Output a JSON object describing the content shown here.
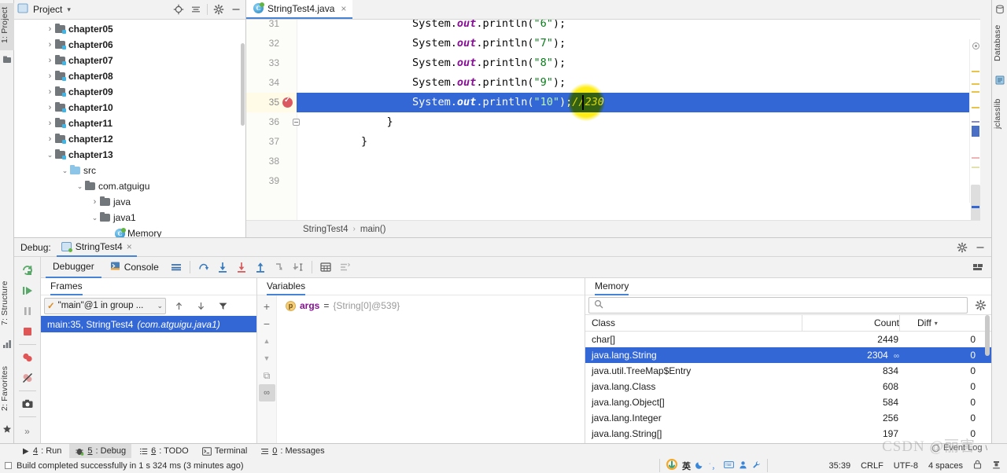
{
  "leftbar": {
    "top_items": [
      {
        "label": "1: Project",
        "selected": true
      }
    ],
    "bottom_items": [
      {
        "label": "7: Structure"
      },
      {
        "label": "2: Favorites"
      }
    ]
  },
  "project_panel": {
    "title": "Project",
    "dropdown_caret": "▾",
    "icons": [
      {
        "name": "locate-icon",
        "glyph": "⊕"
      },
      {
        "name": "collapse-all-icon",
        "glyph": "≑"
      },
      {
        "name": "settings-gear-icon",
        "glyph": "✿"
      },
      {
        "name": "hide-panel-icon",
        "glyph": "—"
      }
    ],
    "tree": [
      {
        "label": "chapter05",
        "indent": 1,
        "arrow": "›",
        "icon": "folder-module",
        "bold": true
      },
      {
        "label": "chapter06",
        "indent": 1,
        "arrow": "›",
        "icon": "folder-module",
        "bold": true
      },
      {
        "label": "chapter07",
        "indent": 1,
        "arrow": "›",
        "icon": "folder-module",
        "bold": true
      },
      {
        "label": "chapter08",
        "indent": 1,
        "arrow": "›",
        "icon": "folder-module",
        "bold": true
      },
      {
        "label": "chapter09",
        "indent": 1,
        "arrow": "›",
        "icon": "folder-module",
        "bold": true
      },
      {
        "label": "chapter10",
        "indent": 1,
        "arrow": "›",
        "icon": "folder-module",
        "bold": true
      },
      {
        "label": "chapter11",
        "indent": 1,
        "arrow": "›",
        "icon": "folder-module",
        "bold": true
      },
      {
        "label": "chapter12",
        "indent": 1,
        "arrow": "›",
        "icon": "folder-module",
        "bold": true
      },
      {
        "label": "chapter13",
        "indent": 1,
        "arrow": "⌄",
        "icon": "folder-module",
        "bold": true
      },
      {
        "label": "src",
        "indent": 2,
        "arrow": "⌄",
        "icon": "folder-src",
        "bold": false
      },
      {
        "label": "com.atguigu",
        "indent": 3,
        "arrow": "⌄",
        "icon": "folder-pkg",
        "bold": false
      },
      {
        "label": "java",
        "indent": 4,
        "arrow": "›",
        "icon": "folder-pkg",
        "bold": false
      },
      {
        "label": "java1",
        "indent": 4,
        "arrow": "⌄",
        "icon": "folder-pkg",
        "bold": false
      },
      {
        "label": "Memory",
        "indent": 5,
        "arrow": "",
        "icon": "java-class",
        "bold": false
      }
    ]
  },
  "editor": {
    "tab": {
      "label": "StringTest4.java",
      "close": "×",
      "icon": "java-class-icon"
    },
    "lines": [
      {
        "num": "31",
        "clipped": true,
        "segments": [
          {
            "t": "        System.",
            "c": "plain"
          },
          {
            "t": "out",
            "c": "field"
          },
          {
            "t": ".println(",
            "c": "plain"
          },
          {
            "t": "\"6\"",
            "c": "string"
          },
          {
            "t": ");",
            "c": "plain"
          }
        ]
      },
      {
        "num": "32",
        "segments": [
          {
            "t": "        System.",
            "c": "plain"
          },
          {
            "t": "out",
            "c": "field"
          },
          {
            "t": ".println(",
            "c": "plain"
          },
          {
            "t": "\"7\"",
            "c": "string"
          },
          {
            "t": ");",
            "c": "plain"
          }
        ]
      },
      {
        "num": "33",
        "segments": [
          {
            "t": "        System.",
            "c": "plain"
          },
          {
            "t": "out",
            "c": "field"
          },
          {
            "t": ".println(",
            "c": "plain"
          },
          {
            "t": "\"8\"",
            "c": "string"
          },
          {
            "t": ");",
            "c": "plain"
          }
        ]
      },
      {
        "num": "34",
        "segments": [
          {
            "t": "        System.",
            "c": "plain"
          },
          {
            "t": "out",
            "c": "field"
          },
          {
            "t": ".println(",
            "c": "plain"
          },
          {
            "t": "\"9\"",
            "c": "string"
          },
          {
            "t": ");",
            "c": "plain"
          }
        ]
      },
      {
        "num": "35",
        "selected": true,
        "breakpoint": true,
        "segments": [
          {
            "t": "        System.",
            "c": "plain"
          },
          {
            "t": "out",
            "c": "field"
          },
          {
            "t": ".println(",
            "c": "plain"
          },
          {
            "t": "\"10\"",
            "c": "string"
          },
          {
            "t": ");",
            "c": "plain"
          },
          {
            "t": "//230",
            "c": "comment"
          }
        ]
      },
      {
        "num": "36",
        "fold": true,
        "segments": [
          {
            "t": "    }",
            "c": "plain"
          }
        ]
      },
      {
        "num": "37",
        "segments": [
          {
            "t": "}",
            "c": "plain"
          }
        ]
      },
      {
        "num": "38",
        "segments": [
          {
            "t": "",
            "c": "plain"
          }
        ]
      },
      {
        "num": "39",
        "segments": [
          {
            "t": "",
            "c": "plain"
          }
        ]
      }
    ],
    "breadcrumb": {
      "class": "StringTest4",
      "sep": "›",
      "method": "main()"
    }
  },
  "rightbar": {
    "items": [
      {
        "label": "Database",
        "icon": "database-icon"
      },
      {
        "label": "jclasslib",
        "icon": "jclasslib-icon"
      }
    ]
  },
  "debug": {
    "header": {
      "label": "Debug:",
      "session": "StringTest4",
      "close": "×"
    },
    "side_buttons": [
      {
        "name": "rerun-button",
        "glyph": "⟳"
      },
      {
        "name": "resume-program-button",
        "glyph": "▶"
      },
      {
        "name": "pause-program-button",
        "glyph": "❚❚"
      },
      {
        "name": "stop-button",
        "glyph": "■"
      },
      {
        "name": "view-breakpoints-button",
        "glyph": "◍"
      },
      {
        "name": "mute-breakpoints-button",
        "glyph": "⃠"
      },
      {
        "name": "snapshot-button",
        "glyph": "▣"
      },
      {
        "name": "expand-toolbar-button",
        "glyph": "»"
      }
    ],
    "tabs": [
      {
        "label": "Debugger",
        "active": true,
        "icon": ""
      },
      {
        "label": "Console",
        "active": false,
        "icon": "console-icon"
      }
    ],
    "toolbar_icons": [
      {
        "name": "layout-settings-icon",
        "glyph": "≡"
      },
      {
        "name": "step-over-icon",
        "glyph": "⤼"
      },
      {
        "name": "step-into-icon",
        "glyph": "↓"
      },
      {
        "name": "force-step-into-icon",
        "glyph": "↓"
      },
      {
        "name": "step-out-icon",
        "glyph": "↑"
      },
      {
        "name": "drop-frame-icon",
        "glyph": "⤴"
      },
      {
        "name": "run-to-cursor-icon",
        "glyph": "⤵"
      },
      {
        "name": "evaluate-expression-icon",
        "glyph": "▦"
      },
      {
        "name": "trace-icon",
        "glyph": "⇶"
      }
    ],
    "settings_icon": "✿",
    "minimize_icon": "—",
    "layout_icon": "▤",
    "frames": {
      "title": "Frames",
      "thread": "\"main\"@1 in group ...",
      "thread_check": "✓",
      "caret": "⌄",
      "tool_icons": [
        {
          "name": "frame-up-icon",
          "glyph": "↑"
        },
        {
          "name": "frame-down-icon",
          "glyph": "↓"
        },
        {
          "name": "filter-frames-icon",
          "glyph": "▼"
        }
      ],
      "rows": [
        {
          "text": "main:35, StringTest4",
          "italic": "(com.atguigu.java1)",
          "selected": true
        }
      ]
    },
    "variables": {
      "title": "Variables",
      "rail_buttons": [
        {
          "name": "add-watch-icon",
          "glyph": "+"
        },
        {
          "name": "remove-watch-icon",
          "glyph": "−"
        },
        {
          "name": "move-up-icon",
          "glyph": "▲"
        },
        {
          "name": "move-down-icon",
          "glyph": "▼"
        },
        {
          "name": "copy-value-icon",
          "glyph": "⧉"
        },
        {
          "name": "inspect-icon",
          "glyph": "∞",
          "active": true
        }
      ],
      "rows": [
        {
          "badge": "p",
          "name": "args",
          "eq": "=",
          "value": "{String[0]@539}"
        }
      ]
    },
    "memory": {
      "title": "Memory",
      "search_placeholder": "",
      "search_icon": "search-icon",
      "gear_icon": "settings-gear-icon",
      "columns": [
        "Class",
        "Count",
        "Diff"
      ],
      "sort_caret": "▾",
      "rows": [
        {
          "class": "char[]",
          "count": "2449",
          "diff": "0"
        },
        {
          "class": "java.lang.String",
          "count": "2304",
          "diff": "0",
          "selected": true,
          "glasses": "∞"
        },
        {
          "class": "java.util.TreeMap$Entry",
          "count": "834",
          "diff": "0"
        },
        {
          "class": "java.lang.Class",
          "count": "608",
          "diff": "0"
        },
        {
          "class": "java.lang.Object[]",
          "count": "584",
          "diff": "0"
        },
        {
          "class": "java.lang.Integer",
          "count": "256",
          "diff": "0"
        },
        {
          "class": "java.lang.String[]",
          "count": "197",
          "diff": "0"
        }
      ]
    }
  },
  "toolwindow_bar": [
    {
      "num": "4",
      "label": ": Run",
      "icon": "run-icon",
      "active": false
    },
    {
      "num": "5",
      "label": ": Debug",
      "icon": "debug-icon",
      "active": true
    },
    {
      "num": "6",
      "label": ": TODO",
      "icon": "todo-icon",
      "active": false
    },
    {
      "num": "",
      "label": "Terminal",
      "icon": "terminal-icon",
      "active": false
    },
    {
      "num": "0",
      "label": ": Messages",
      "icon": "messages-icon",
      "active": false
    }
  ],
  "statusbar": {
    "message": "Build completed successfully in 1 s 324 ms (3 minutes ago)",
    "ime": [
      "英"
    ],
    "position": "35:39",
    "line_separator": "CRLF",
    "encoding": "UTF-8",
    "indent": "4 spaces",
    "lock_icon": "lock-icon",
    "inspection_icon": "inspection-icon",
    "event_log": "Event Log",
    "watermark": "CSDN @丽害"
  }
}
